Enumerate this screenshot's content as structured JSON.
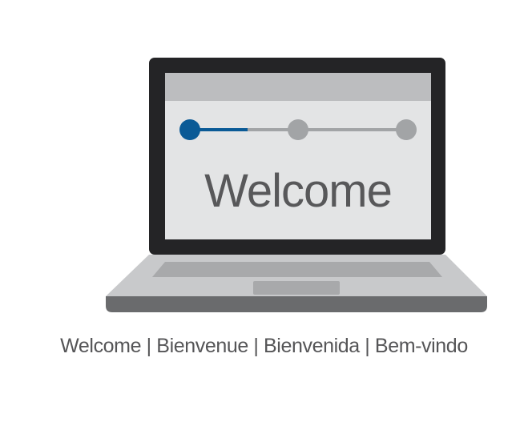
{
  "screen": {
    "heading": "Welcome",
    "progress": {
      "total_steps": 3,
      "current_step": 1
    }
  },
  "caption": "Welcome | Bienvenue | Bienvenida | Bem-vindo",
  "colors": {
    "accent": "#0a5a96",
    "track": "#a2a4a6",
    "screen_bg": "#e3e4e5",
    "header_bar": "#bcbdbf",
    "bezel": "#242426",
    "deck": "#c8c9cb",
    "base_edge": "#6a6b6d",
    "text": "#58585a"
  }
}
